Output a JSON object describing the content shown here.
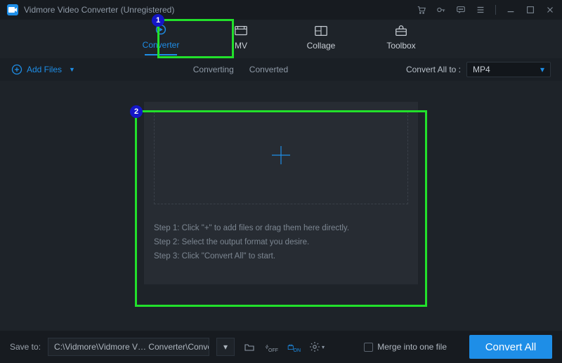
{
  "window": {
    "title": "Vidmore Video Converter (Unregistered)"
  },
  "tabs": {
    "converter": "Converter",
    "mv": "MV",
    "collage": "Collage",
    "toolbox": "Toolbox"
  },
  "subbar": {
    "add_files": "Add Files",
    "converting": "Converting",
    "converted": "Converted",
    "convert_all_to": "Convert All to :",
    "format": "MP4"
  },
  "dropzone": {
    "step1": "Step 1: Click \"+\" to add files or drag them here directly.",
    "step2": "Step 2: Select the output format you desire.",
    "step3": "Step 3: Click \"Convert All\" to start."
  },
  "bottom": {
    "save_to": "Save to:",
    "path": "C:\\Vidmore\\Vidmore V… Converter\\Converted",
    "merge": "Merge into one file",
    "convert_all": "Convert All"
  },
  "annotations": {
    "b1": "1",
    "b2": "2"
  }
}
